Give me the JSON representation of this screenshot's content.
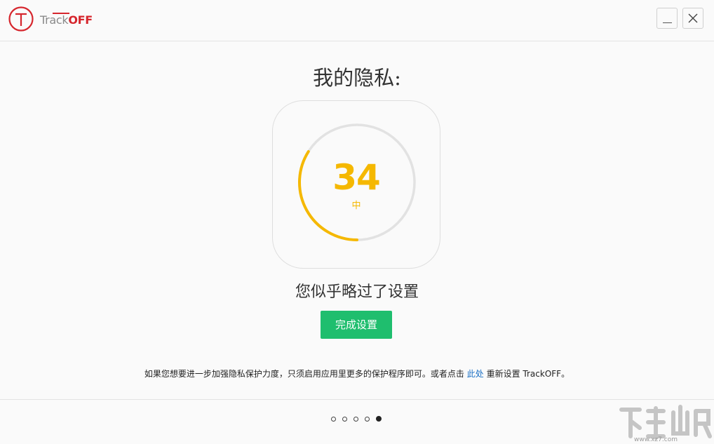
{
  "app": {
    "logo_track": "Track",
    "logo_off": "OFF",
    "brand_color": "#d6262d"
  },
  "window_controls": {
    "minimize_icon": "minimize-icon",
    "close_icon": "close-icon"
  },
  "main": {
    "title": "我的隐私:",
    "score": {
      "value": "34",
      "level": "中",
      "max": 100,
      "color": "#f5b800",
      "track_color": "#e2e2e2"
    },
    "subtitle": "您似乎略过了设置",
    "finish_button": "完成设置",
    "finish_button_color": "#1fbe6e",
    "note_before": "如果您想要进一步加强隐私保护力度，只须启用应用里更多的保护程序即可。或者点击",
    "note_link": "此处",
    "note_after": "重新设置 TrackOFF。"
  },
  "pagination": {
    "total": 5,
    "active_index": 4
  },
  "watermark": {
    "text": "www.xz7.com"
  }
}
